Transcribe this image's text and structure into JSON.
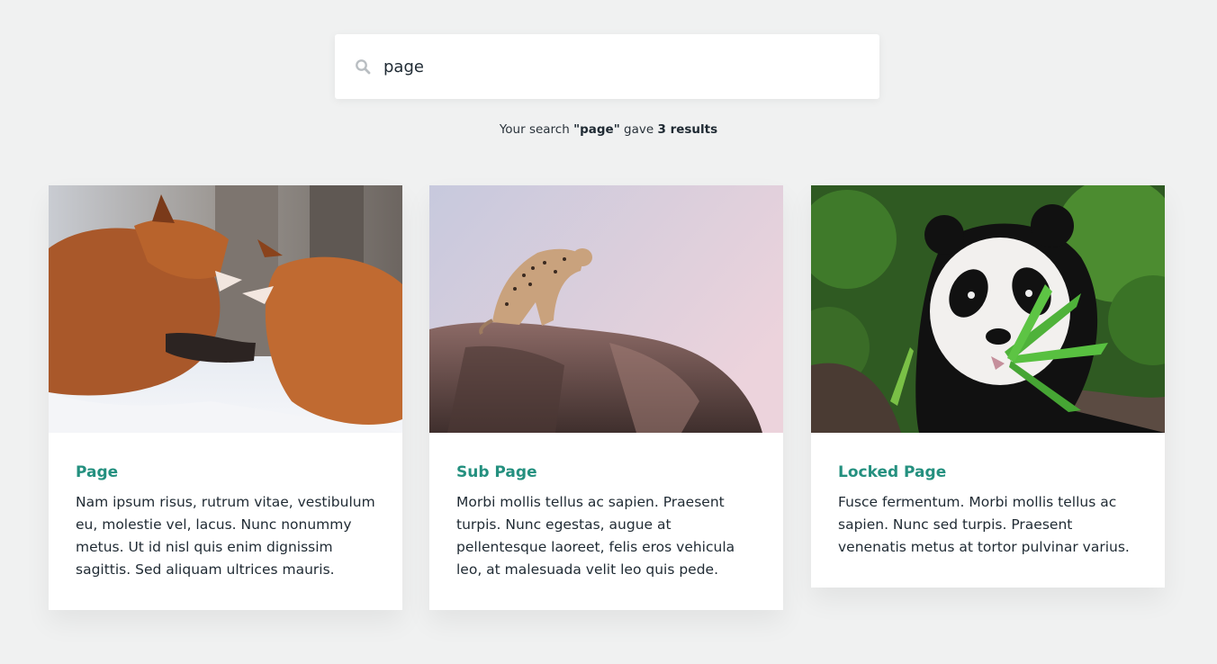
{
  "search": {
    "value": "page",
    "icon": "search-icon"
  },
  "summary": {
    "prefix": "Your search ",
    "query": "\"page\"",
    "middle": " gave ",
    "count": "3 results"
  },
  "colors": {
    "accent": "#24907f",
    "background": "#f0f1f1"
  },
  "results": [
    {
      "title": "Page",
      "text": "Nam ipsum risus, rutrum vitae, vestibulum eu, molestie vel, lacus. Nunc nonummy metus. Ut id nisl quis enim dignissim sagittis. Sed aliquam ultrices mauris.",
      "image": "fox-photo"
    },
    {
      "title": "Sub Page",
      "text": "Morbi mollis tellus ac sapien. Praesent turpis. Nunc egestas, augue at pellentesque laoreet, felis eros vehicula leo, at malesuada velit leo quis pede.",
      "image": "leopard-photo"
    },
    {
      "title": "Locked Page",
      "text": "Fusce fermentum. Morbi mollis tellus ac sapien. Nunc sed turpis. Praesent venenatis metus at tortor pulvinar varius.",
      "image": "panda-photo"
    }
  ]
}
